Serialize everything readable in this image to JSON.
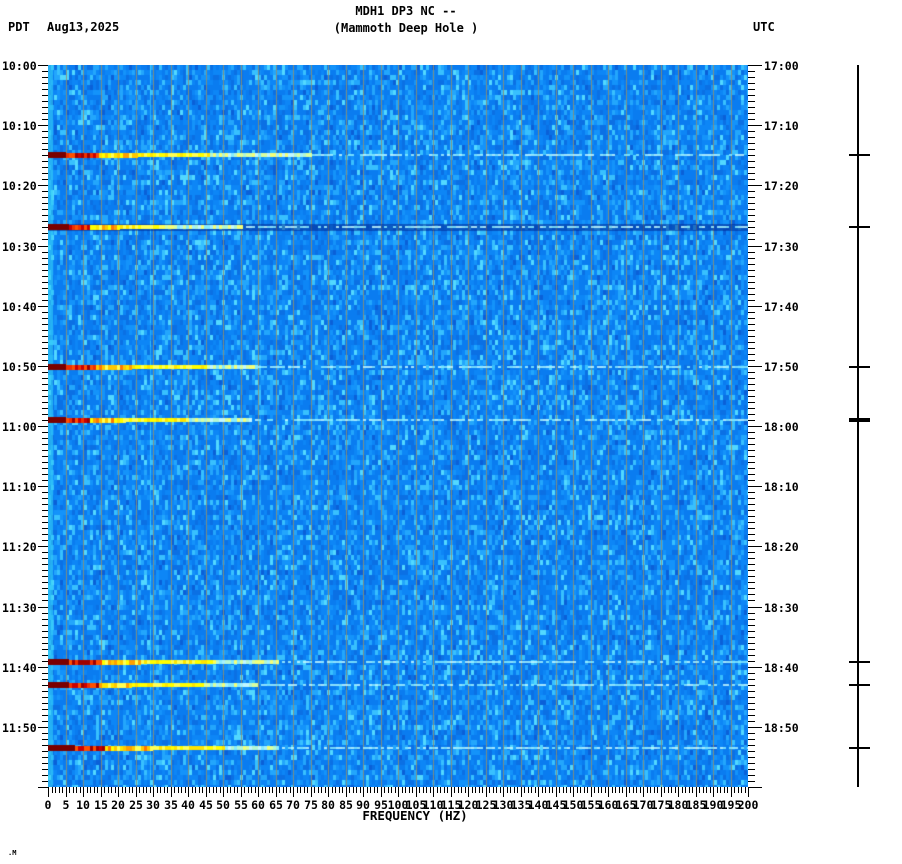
{
  "header": {
    "timezone_left": "PDT",
    "date": "Aug13,2025",
    "title_line1": "MDH1 DP3 NC --",
    "title_line2": "(Mammoth Deep Hole )",
    "timezone_right": "UTC"
  },
  "footer": {
    "mark": ".M"
  },
  "chart_data": {
    "type": "heatmap",
    "title": "MDH1 DP3 NC --",
    "subtitle": "(Mammoth Deep Hole )",
    "xlabel": "FREQUENCY (HZ)",
    "x_min_hz": 0,
    "x_max_hz": 200,
    "x_major_tick_hz": 5,
    "x_minor_tick_hz": 1,
    "x_tick_labels": [
      "0",
      "5",
      "10",
      "15",
      "20",
      "25",
      "30",
      "35",
      "40",
      "45",
      "50",
      "55",
      "60",
      "65",
      "70",
      "75",
      "80",
      "85",
      "90",
      "95",
      "100",
      "105",
      "110",
      "115",
      "120",
      "125",
      "130",
      "135",
      "140",
      "145",
      "150",
      "155",
      "160",
      "165",
      "170",
      "175",
      "180",
      "185",
      "190",
      "195",
      "200"
    ],
    "time_span_minutes": 120,
    "minor_tick_minutes": 1,
    "major_tick_minutes": 10,
    "left_time_labels": [
      "10:00",
      "10:10",
      "10:20",
      "10:30",
      "10:40",
      "10:50",
      "11:00",
      "11:10",
      "11:20",
      "11:30",
      "11:40",
      "11:50"
    ],
    "right_time_labels": [
      "17:00",
      "17:10",
      "17:20",
      "17:30",
      "17:40",
      "17:50",
      "18:00",
      "18:10",
      "18:20",
      "18:30",
      "18:40",
      "18:50"
    ],
    "grid": {
      "color": "#8f9070",
      "alpha": 0.85,
      "step_hz": 5
    },
    "background_palette": [
      {
        "c": "#0a7cf0",
        "w": 0.3
      },
      {
        "c": "#0d86f6",
        "w": 0.2
      },
      {
        "c": "#0b70e4",
        "w": 0.14
      },
      {
        "c": "#1493fa",
        "w": 0.12
      },
      {
        "c": "#23a6fc",
        "w": 0.1
      },
      {
        "c": "#38c0fe",
        "w": 0.08
      },
      {
        "c": "#52d8ff",
        "w": 0.04
      },
      {
        "c": "#0a60d8",
        "w": 0.02
      }
    ],
    "low_freq_edge_band": {
      "to_hz": 1.3,
      "color": "#35d0f5",
      "alpha": 0.6
    },
    "tone_lines": [
      {
        "hz": 29.0,
        "color": "#45e0ff",
        "alpha": 0.75
      },
      {
        "hz": 60.6,
        "color": "#35c0ff",
        "alpha": 0.5
      }
    ],
    "event_palette": {
      "dark_red": "#7a0000",
      "reds": [
        "#a00000",
        "#cc0000",
        "#f03000",
        "#ff5000"
      ],
      "oranges": [
        "#ff7800",
        "#ffa000",
        "#ffc800"
      ],
      "yellows": [
        "#ffe400",
        "#ffff00",
        "#ffff55"
      ],
      "pales": [
        "#f2ff7a",
        "#d8ffa0",
        "#b4f7d2"
      ],
      "tail": [
        "#86ecff",
        "#a4f2ff",
        "#c2f7ff"
      ],
      "full_width_band": "rgba(0,34,140,0.5)"
    },
    "events": [
      {
        "pdt": "10:15",
        "utc": "17:15",
        "minutes": 15.0,
        "dark_red_to_hz": 5,
        "red_to_hz": 14,
        "orange_to_hz": 25,
        "yellow_to_hz": 46,
        "pale_to_hz": 75,
        "tail_to_hz": 200,
        "full_width_dark_band": false,
        "marker_bold": false
      },
      {
        "pdt": "10:27",
        "utc": "17:27",
        "minutes": 27.0,
        "dark_red_to_hz": 6,
        "red_to_hz": 12,
        "orange_to_hz": 20,
        "yellow_to_hz": 33,
        "pale_to_hz": 55,
        "tail_to_hz": 200,
        "full_width_dark_band": true,
        "marker_bold": false
      },
      {
        "pdt": "10:50",
        "utc": "17:50",
        "minutes": 50.2,
        "dark_red_to_hz": 5,
        "red_to_hz": 13,
        "orange_to_hz": 24,
        "yellow_to_hz": 45,
        "pale_to_hz": 60,
        "tail_to_hz": 200,
        "full_width_dark_band": false,
        "marker_bold": false
      },
      {
        "pdt": "10:59",
        "utc": "17:59",
        "minutes": 59.0,
        "dark_red_to_hz": 5,
        "red_to_hz": 12,
        "orange_to_hz": 22,
        "yellow_to_hz": 40,
        "pale_to_hz": 58,
        "tail_to_hz": 200,
        "full_width_dark_band": false,
        "marker_bold": true
      },
      {
        "pdt": "11:39",
        "utc": "18:39",
        "minutes": 99.2,
        "dark_red_to_hz": 6,
        "red_to_hz": 15,
        "orange_to_hz": 26,
        "yellow_to_hz": 48,
        "pale_to_hz": 66,
        "tail_to_hz": 200,
        "full_width_dark_band": false,
        "marker_bold": false
      },
      {
        "pdt": "11:43",
        "utc": "18:43",
        "minutes": 103.0,
        "dark_red_to_hz": 6,
        "red_to_hz": 14,
        "orange_to_hz": 24,
        "yellow_to_hz": 44,
        "pale_to_hz": 60,
        "tail_to_hz": 200,
        "full_width_dark_band": false,
        "marker_bold": false
      },
      {
        "pdt": "11:53",
        "utc": "18:53",
        "minutes": 113.5,
        "dark_red_to_hz": 7,
        "red_to_hz": 16,
        "orange_to_hz": 30,
        "yellow_to_hz": 50,
        "pale_to_hz": 66,
        "tail_to_hz": 200,
        "full_width_dark_band": false,
        "marker_bold": false
      }
    ]
  }
}
